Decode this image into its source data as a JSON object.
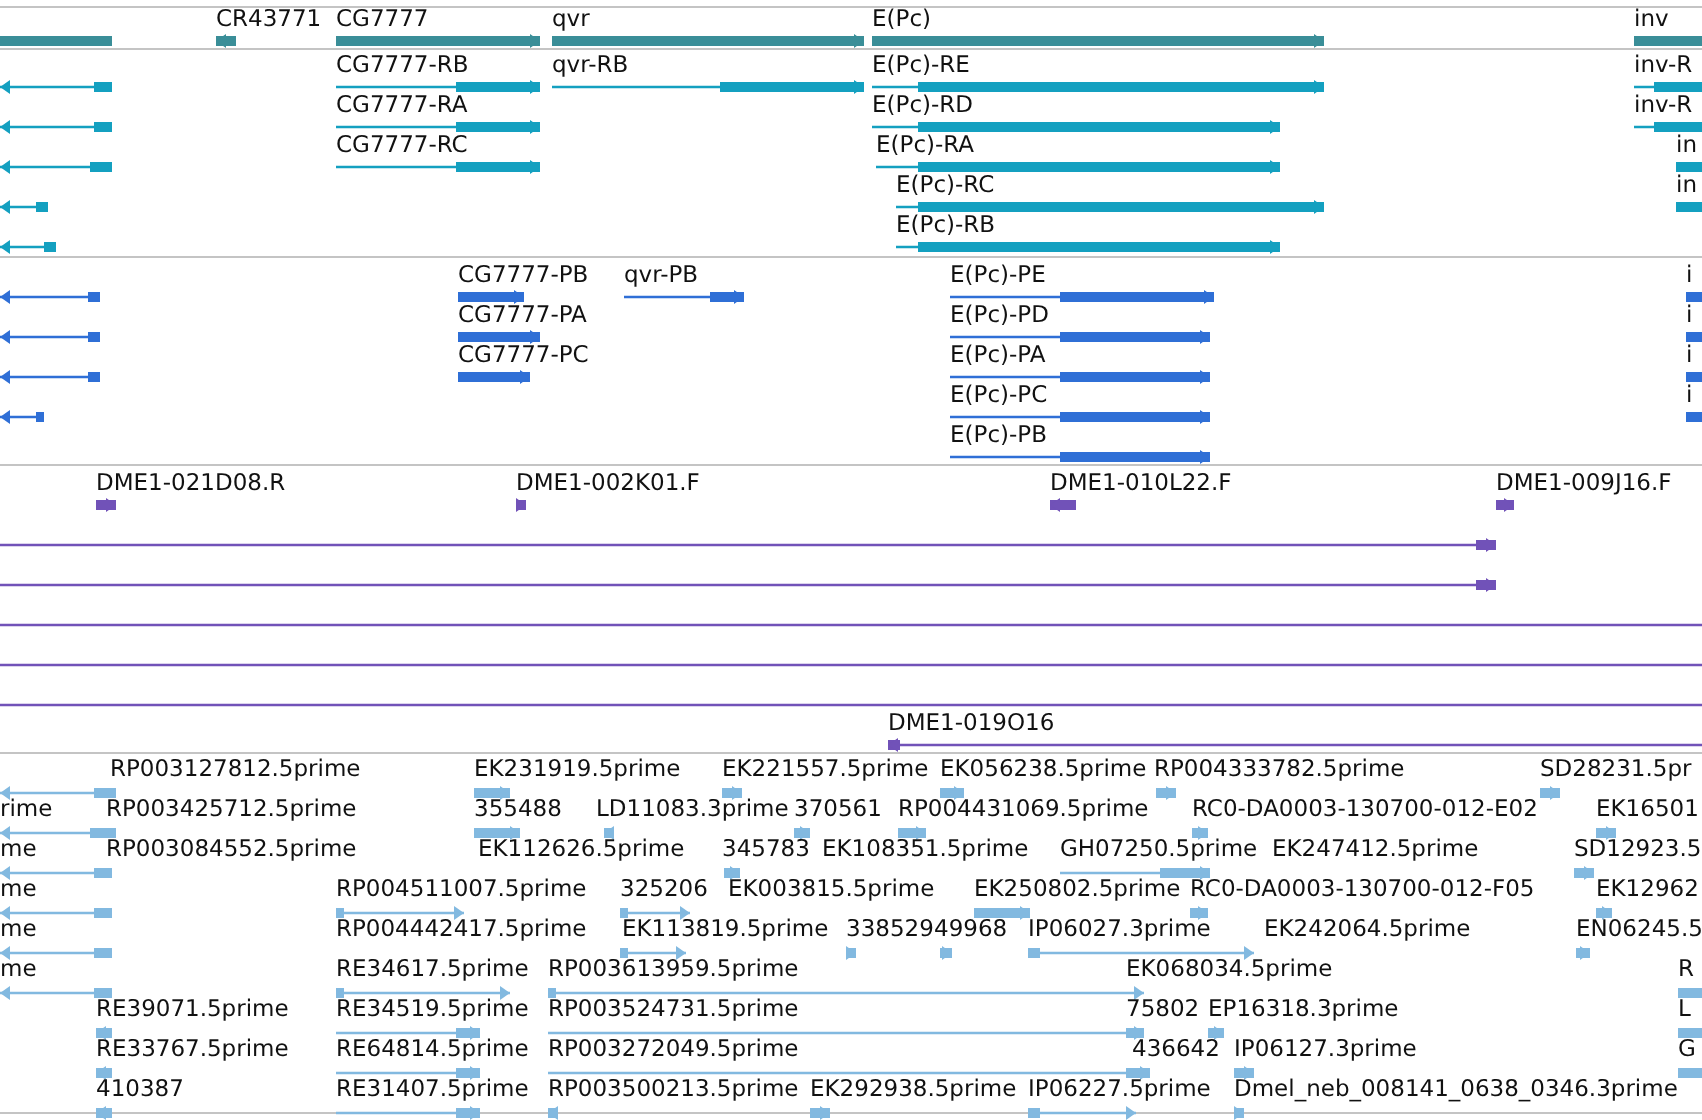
{
  "tracks": [
    {
      "kind": "gene",
      "features": [
        {
          "label": "CR43771"
        },
        {
          "label": "CG7777"
        },
        {
          "label": "qvr"
        },
        {
          "label": "E(Pc)"
        },
        {
          "label": "inv"
        }
      ]
    },
    {
      "kind": "transcript",
      "features": [
        {
          "label": "CG7777-RB"
        },
        {
          "label": "qvr-RB"
        },
        {
          "label": "E(Pc)-RE"
        },
        {
          "label": "inv-R"
        },
        {
          "label": "CG7777-RA"
        },
        {
          "label": "E(Pc)-RD"
        },
        {
          "label": "inv-R"
        },
        {
          "label": "CG7777-RC"
        },
        {
          "label": "E(Pc)-RA"
        },
        {
          "label": "in"
        },
        {
          "label": "E(Pc)-RC"
        },
        {
          "label": "in"
        },
        {
          "label": "E(Pc)-RB"
        }
      ]
    },
    {
      "kind": "protein",
      "features": [
        {
          "label": "CG7777-PB"
        },
        {
          "label": "qvr-PB"
        },
        {
          "label": "E(Pc)-PE"
        },
        {
          "label": "i"
        },
        {
          "label": "CG7777-PA"
        },
        {
          "label": "E(Pc)-PD"
        },
        {
          "label": "i"
        },
        {
          "label": "CG7777-PC"
        },
        {
          "label": "E(Pc)-PA"
        },
        {
          "label": "i"
        },
        {
          "label": "E(Pc)-PC"
        },
        {
          "label": "i"
        },
        {
          "label": "E(Pc)-PB"
        }
      ]
    },
    {
      "kind": "clone",
      "features": [
        {
          "label": "DME1-021D08.R"
        },
        {
          "label": "DME1-002K01.F"
        },
        {
          "label": "DME1-010L22.F"
        },
        {
          "label": "DME1-009J16.F"
        },
        {
          "label": "DME1-019O16"
        }
      ]
    },
    {
      "kind": "est",
      "features": [
        {
          "label": "RP003127812.5prime"
        },
        {
          "label": "EK231919.5prime"
        },
        {
          "label": "EK221557.5prime"
        },
        {
          "label": "EK056238.5prime"
        },
        {
          "label": "RP004333782.5prime"
        },
        {
          "label": "SD28231.5pr"
        },
        {
          "label": "rime"
        },
        {
          "label": "RP003425712.5prime"
        },
        {
          "label": "355488"
        },
        {
          "label": "LD11083.3prime"
        },
        {
          "label": "370561"
        },
        {
          "label": "RP004431069.5prime"
        },
        {
          "label": "RC0-DA0003-130700-012-E02"
        },
        {
          "label": "EK16501"
        },
        {
          "label": "me"
        },
        {
          "label": "RP003084552.5prime"
        },
        {
          "label": "EK112626.5prime"
        },
        {
          "label": "345783"
        },
        {
          "label": "EK108351.5prime"
        },
        {
          "label": "GH07250.5prime"
        },
        {
          "label": "EK247412.5prime"
        },
        {
          "label": "SD12923.5"
        },
        {
          "label": "me"
        },
        {
          "label": "RP004511007.5prime"
        },
        {
          "label": "325206"
        },
        {
          "label": "EK003815.5prime"
        },
        {
          "label": "EK250802.5prime"
        },
        {
          "label": "RC0-DA0003-130700-012-F05"
        },
        {
          "label": "EK12962"
        },
        {
          "label": "me"
        },
        {
          "label": "RP004442417.5prime"
        },
        {
          "label": "EK113819.5prime"
        },
        {
          "label": "338529"
        },
        {
          "label": "49968"
        },
        {
          "label": "IP06027.3prime"
        },
        {
          "label": "EK242064.5prime"
        },
        {
          "label": "EN06245.5"
        },
        {
          "label": "me"
        },
        {
          "label": "RE34617.5prime"
        },
        {
          "label": "RP003613959.5prime"
        },
        {
          "label": "EK068034.5prime"
        },
        {
          "label": "R"
        },
        {
          "label": "RE39071.5prime"
        },
        {
          "label": "RE34519.5prime"
        },
        {
          "label": "RP003524731.5prime"
        },
        {
          "label": "75802"
        },
        {
          "label": "EP16318.3prime"
        },
        {
          "label": "L"
        },
        {
          "label": "RE33767.5prime"
        },
        {
          "label": "RE64814.5prime"
        },
        {
          "label": "RP003272049.5prime"
        },
        {
          "label": "436642"
        },
        {
          "label": "IP06127.3prime"
        },
        {
          "label": "G"
        },
        {
          "label": "410387"
        },
        {
          "label": "RE31407.5prime"
        },
        {
          "label": "RP003500213.5prime"
        },
        {
          "label": "EK292938.5prime"
        },
        {
          "label": "IP06227.5prime"
        },
        {
          "label": "Dmel_neb_008141_0638_0346.3prime"
        }
      ]
    }
  ]
}
